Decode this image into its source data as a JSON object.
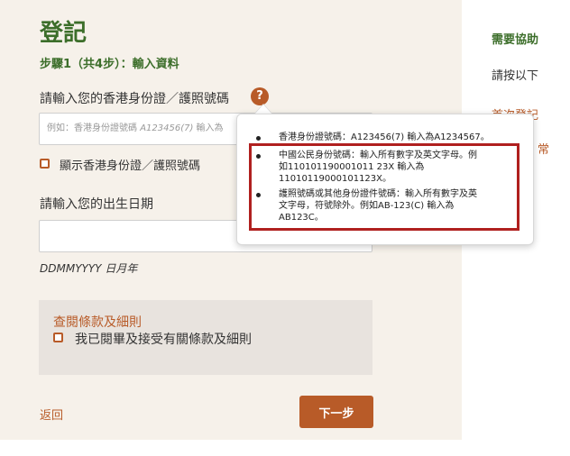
{
  "page": {
    "title": "登記",
    "step": "步驟1（共4步）：輸入資料"
  },
  "id_field": {
    "label": "請輸入您的香港身份證／護照號碼",
    "placeholder_plain": "例如：香港身份證號碼 ",
    "placeholder_italic": "A123456(7)",
    "placeholder_tail": " 輸入為",
    "help_icon": "?",
    "show_label": "顯示香港身份證／護照號碼"
  },
  "dob_field": {
    "label": "請輸入您的出生日期",
    "format_italic": "DDMMYYYY",
    "format_text": " 日月年"
  },
  "terms": {
    "link": "查閱條款及細則",
    "agree_label": "我已閱畢及接受有關條款及細則"
  },
  "actions": {
    "back": "返回",
    "next": "下一步"
  },
  "right_col": {
    "heading": "需要協助",
    "text": "請按以下",
    "link1": "首次登記",
    "link2": "常"
  },
  "tooltip": {
    "item1": "香港身份證號碼：A123456(7) 輸入為A1234567。",
    "item2_l1": "中國公民身份號碼：輸入所有數字及英文字母。例",
    "item2_l2": "如110101190001011 23X 輸入為",
    "item2_l3": "11010119000101123X。",
    "item3_l1": "護照號碼或其他身份證件號碼：輸入所有數字及英",
    "item3_l2": "文字母，符號除外。例如AB-123(C) 輸入為",
    "item3_l3": "AB123C。"
  },
  "colors": {
    "accent": "#b85b28",
    "title_green": "#3c6e2a",
    "highlight_red": "#b0201f"
  }
}
